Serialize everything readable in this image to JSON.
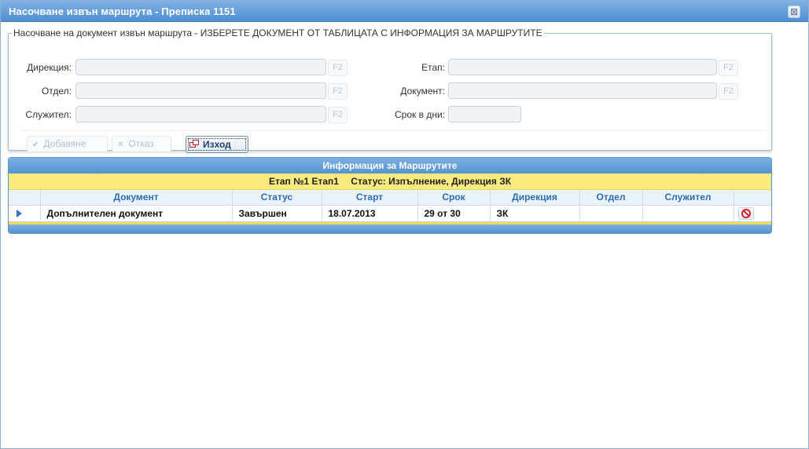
{
  "window": {
    "title": "Насочване извън маршрута - Преписка 1151",
    "close_symbol": "⊠"
  },
  "form": {
    "legend": "Насочване на документ извън маршрута - ИЗБЕРЕТЕ ДОКУМЕНТ ОТ ТАБЛИЦАТА С ИНФОРМАЦИЯ ЗА МАРШРУТИТЕ",
    "f2_label": "F2",
    "fields": {
      "direction_label": "Дирекция:",
      "department_label": "Отдел:",
      "employee_label": "Служител:",
      "stage_label": "Етап:",
      "document_label": "Документ:",
      "days_label": "Срок в дни:"
    },
    "buttons": {
      "add": "Добавяне",
      "cancel": "Отказ",
      "exit": "Изход"
    }
  },
  "grid": {
    "title": "Информация за Маршрутите",
    "group": {
      "stage": "Етап №1 Етап1",
      "status": "Статус: Изпълнение,  Дирекция ЗК"
    },
    "columns": [
      "Документ",
      "Статус",
      "Старт",
      "Срок",
      "Дирекция",
      "Отдел",
      "Служител"
    ],
    "rows": [
      {
        "document": "Допълнителен документ",
        "status": "Завършен",
        "start": "18.07.2013",
        "term": "29 от 30",
        "direction": "ЗК",
        "department": "",
        "employee": ""
      }
    ]
  },
  "icons": {
    "close": "close-icon",
    "row_pointer": "row-pointer-icon",
    "delete": "delete-icon",
    "check": "check-icon",
    "cancel": "x-icon",
    "exit": "exit-icon"
  }
}
